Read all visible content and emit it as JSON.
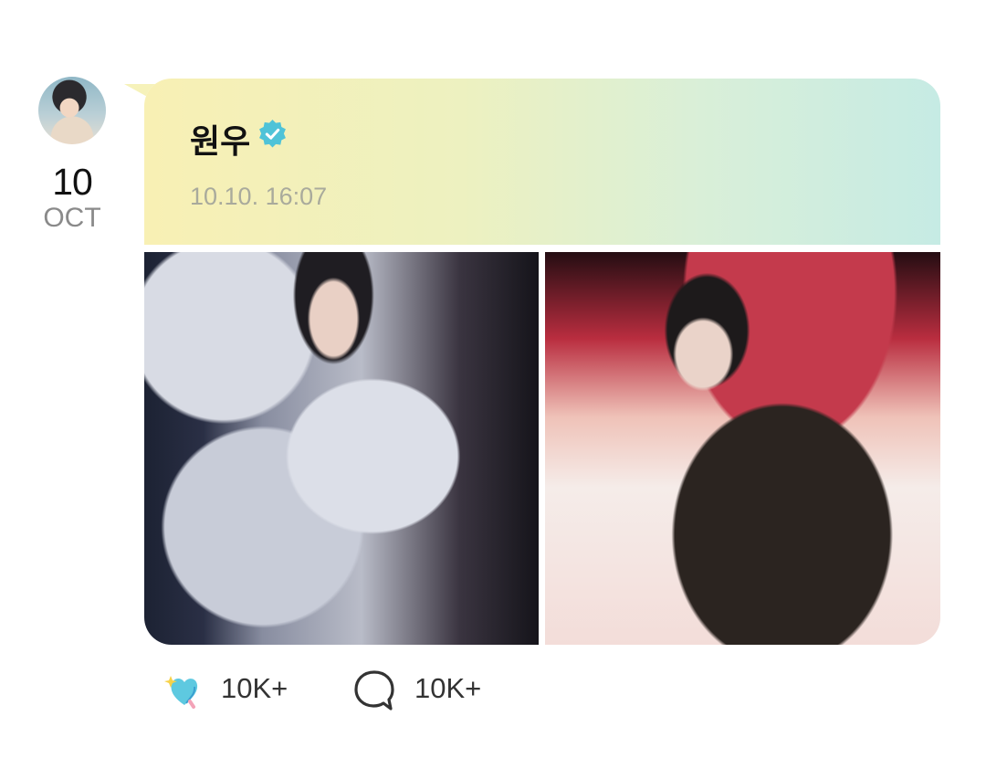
{
  "post": {
    "author": "원우",
    "timestamp": "10.10. 16:07",
    "date_day": "10",
    "date_month": "OCT",
    "verified": true,
    "photo_count": 2
  },
  "reactions": {
    "likes": "10K+",
    "comments": "10K+"
  },
  "icons": {
    "verified": "verified-badge-icon",
    "like": "heart-sparkle-icon",
    "comment": "speech-bubble-icon"
  },
  "colors": {
    "header_gradient_start": "#f8f0b4",
    "header_gradient_end": "#c6ebe4",
    "verified": "#4fc3d8",
    "timestamp": "#a9aa9c"
  }
}
